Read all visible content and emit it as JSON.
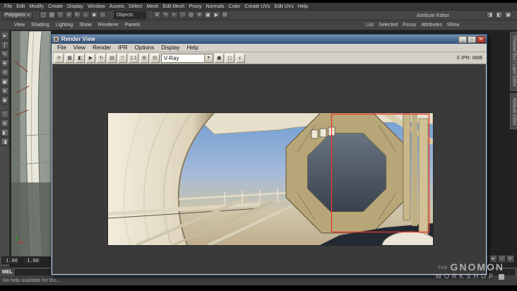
{
  "glyphs": {
    "dropdown_arrow": "▾"
  },
  "colors": {
    "region_outline": "#e8382e"
  },
  "maya": {
    "menus": [
      "File",
      "Edit",
      "Modify",
      "Create",
      "Display",
      "Window",
      "Assets",
      "Select",
      "Mesh",
      "Edit Mesh",
      "Proxy",
      "Normals",
      "Color",
      "Create UVs",
      "Edit UVs",
      "Help"
    ],
    "status": {
      "mode": "Polygons",
      "objects": "Objects"
    },
    "status_icons_left": [
      {
        "name": "new-scene-icon",
        "glyph": "▢"
      },
      {
        "name": "open-scene-icon",
        "glyph": "▤"
      },
      {
        "name": "save-scene-icon",
        "glyph": "▽"
      },
      {
        "name": "undo-icon",
        "glyph": "↺"
      },
      {
        "name": "redo-icon",
        "glyph": "↻"
      },
      {
        "name": "select-hierarchy-icon",
        "glyph": "⌂"
      },
      {
        "name": "select-object-icon",
        "glyph": "◆"
      },
      {
        "name": "select-component-icon",
        "glyph": "◇"
      }
    ],
    "status_icons_right": [
      {
        "name": "snap-to-grid-icon",
        "glyph": "#"
      },
      {
        "name": "snap-to-curve-icon",
        "glyph": "↷"
      },
      {
        "name": "snap-to-point-icon",
        "glyph": "•"
      },
      {
        "name": "snap-to-plane-icon",
        "glyph": "□"
      },
      {
        "name": "make-live-icon",
        "glyph": "◎"
      },
      {
        "name": "construction-history-icon",
        "glyph": "≡"
      },
      {
        "name": "render-current-frame-icon",
        "glyph": "▣"
      },
      {
        "name": "ipr-render-icon",
        "glyph": "▶"
      },
      {
        "name": "render-settings-icon",
        "glyph": "☰"
      }
    ],
    "sidebar_toggles": [
      {
        "name": "toggle-attribute-editor-icon",
        "glyph": "◨"
      },
      {
        "name": "toggle-tool-settings-icon",
        "glyph": "◧"
      },
      {
        "name": "toggle-channel-box-icon",
        "glyph": "▣"
      }
    ],
    "panel_menus": [
      "View",
      "Shading",
      "Lighting",
      "Show",
      "Renderer",
      "Panels"
    ],
    "ae": {
      "title": "Attribute Editor",
      "menus": [
        "List",
        "Selected",
        "Focus",
        "Attributes",
        "Show"
      ]
    },
    "side_tabs": [
      {
        "name": "tab-channel-box-layer-editor",
        "label": "Channel Box / Layer Editor"
      },
      {
        "name": "tab-attribute-editor",
        "label": "Attribute Editor"
      }
    ],
    "toolbox_tools": [
      {
        "name": "select-tool-icon",
        "glyph": "➤"
      },
      {
        "name": "lasso-tool-icon",
        "glyph": "ʃ"
      },
      {
        "name": "paint-select-tool-icon",
        "glyph": "✎"
      },
      {
        "name": "move-tool-icon",
        "glyph": "✥"
      },
      {
        "name": "rotate-tool-icon",
        "glyph": "⟲"
      },
      {
        "name": "scale-tool-icon",
        "glyph": "▣"
      },
      {
        "name": "universal-manipulator-icon",
        "glyph": "⊕"
      },
      {
        "name": "soft-mod-tool-icon",
        "glyph": "◉"
      }
    ],
    "toolbox_layouts": [
      {
        "name": "single-pane-layout-icon",
        "glyph": "□"
      },
      {
        "name": "four-pane-layout-icon",
        "glyph": "⊞"
      },
      {
        "name": "persp-outliner-layout-icon",
        "glyph": "◧"
      },
      {
        "name": "hypershade-persp-layout-icon",
        "glyph": "◨"
      }
    ],
    "timeline": {
      "range_start": "1.00",
      "range_end": "1.00"
    },
    "playback": [
      {
        "name": "go-to-start-button",
        "glyph": "«"
      },
      {
        "name": "step-back-button",
        "glyph": "‹"
      },
      {
        "name": "play-backwards-button",
        "glyph": "◂"
      },
      {
        "name": "play-forwards-button",
        "glyph": "▸"
      },
      {
        "name": "step-forward-button",
        "glyph": "›"
      },
      {
        "name": "go-to-end-button",
        "glyph": "»"
      }
    ],
    "command_line": {
      "label": "MEL"
    },
    "help_line": "No help available for this..."
  },
  "render_view": {
    "title": "Render View",
    "window_icon_glyph": "▦",
    "window_buttons": [
      {
        "name": "minimize-button",
        "glyph": "_"
      },
      {
        "name": "maximize-button",
        "glyph": "□"
      },
      {
        "name": "close-button",
        "glyph": "✕"
      }
    ],
    "menus": [
      "File",
      "View",
      "Render",
      "IPR",
      "Options",
      "Display",
      "Help"
    ],
    "toolbar_icons_left": [
      {
        "name": "redo-previous-render-icon",
        "glyph": "⟳"
      },
      {
        "name": "redo-region-render-icon",
        "glyph": "▦"
      },
      {
        "name": "snapshot-icon",
        "glyph": "◧"
      },
      {
        "name": "ipr-render-icon",
        "glyph": "▶"
      },
      {
        "name": "refresh-ipr-icon",
        "glyph": "↻"
      },
      {
        "name": "open-image-icon",
        "glyph": "▤"
      },
      {
        "name": "save-image-icon",
        "glyph": "▽"
      },
      {
        "name": "one-to-one-icon",
        "glyph": "1:1"
      },
      {
        "name": "keep-image-icon",
        "glyph": "⊞"
      },
      {
        "name": "remove-image-icon",
        "glyph": "⊟"
      }
    ],
    "renderer": "V-Ray",
    "toolbar_icons_right": [
      {
        "name": "display-rgb-channels-icon",
        "glyph": "◼"
      },
      {
        "name": "display-alpha-channel-icon",
        "glyph": "◻"
      },
      {
        "name": "exposure-icon",
        "glyph": "◐"
      }
    ],
    "pause_ipr_glyph": "‖",
    "ipr_status": "IPR: 0MB"
  },
  "watermark": {
    "prefix": "THE",
    "name": "GNOMON",
    "line2": "WORKSHOP"
  }
}
